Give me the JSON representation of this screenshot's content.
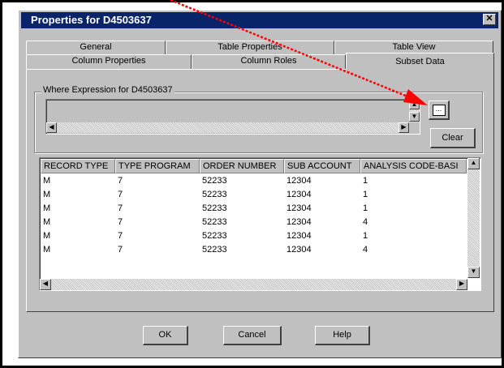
{
  "window": {
    "title": "Properties for D4503637"
  },
  "tabs_back": [
    "General",
    "Table Properties",
    "Table View"
  ],
  "tabs_front": [
    "Column Properties",
    "Column Roles",
    "Subset Data"
  ],
  "where": {
    "label": "Where Expression for D4503637",
    "value": "",
    "builder_label": "...",
    "clear_label": "Clear"
  },
  "table": {
    "columns": [
      "RECORD TYPE",
      "TYPE PROGRAM",
      "ORDER NUMBER",
      "SUB ACCOUNT",
      "ANALYSIS CODE-BASI"
    ],
    "rows": [
      [
        "M",
        "7",
        "52233",
        "12304",
        "1"
      ],
      [
        "M",
        "7",
        "52233",
        "12304",
        "1"
      ],
      [
        "M",
        "7",
        "52233",
        "12304",
        "1"
      ],
      [
        "M",
        "7",
        "52233",
        "12304",
        "4"
      ],
      [
        "M",
        "7",
        "52233",
        "12304",
        "1"
      ],
      [
        "M",
        "7",
        "52233",
        "12304",
        "4"
      ]
    ]
  },
  "buttons": {
    "ok": "OK",
    "cancel": "Cancel",
    "help": "Help"
  },
  "accent": {
    "titlebar": "#0a246a",
    "arrow": "#ff0000"
  }
}
